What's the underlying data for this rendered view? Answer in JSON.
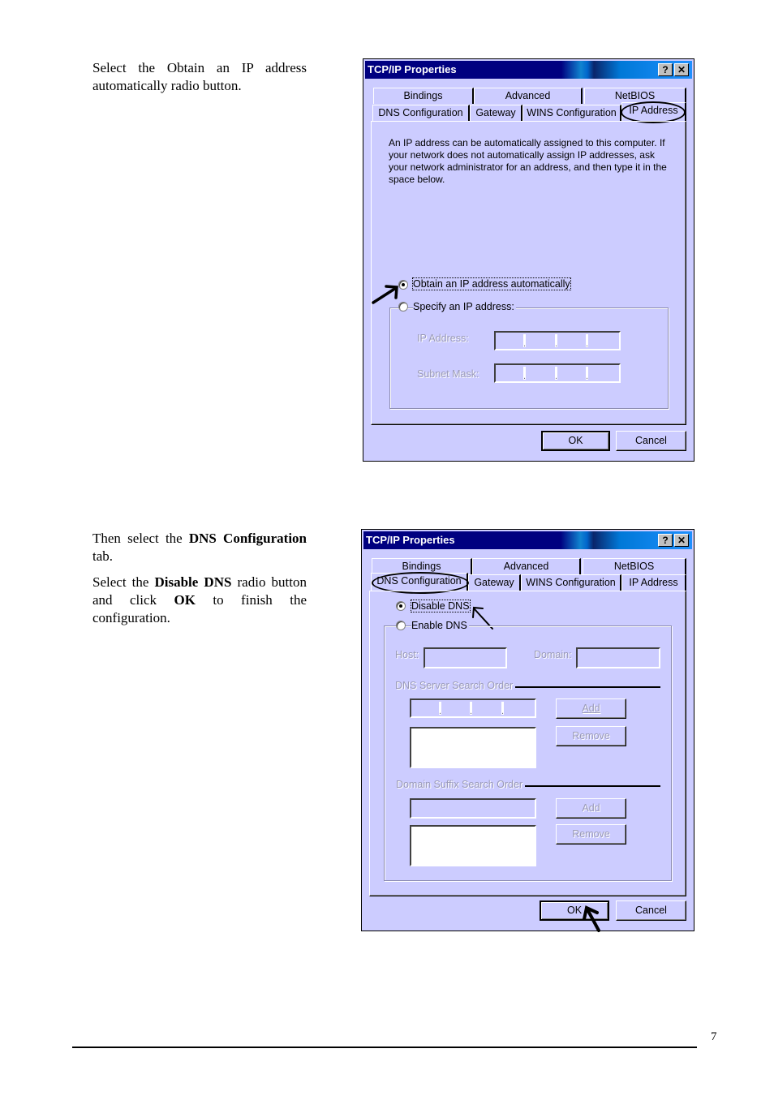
{
  "instructions": {
    "step1": "Select the Obtain an IP address automatically radio button.",
    "step2": {
      "pre": "Then select the ",
      "bold": "DNS Configuration",
      "post": " tab."
    },
    "step3": {
      "pre": "Select the ",
      "bold1": "Disable DNS",
      "mid": " radio button and click ",
      "bold2": "OK",
      "post": " to finish the configuration."
    }
  },
  "page_number": "7",
  "dialog1": {
    "title": "TCP/IP Properties",
    "help_button": "?",
    "close_button": "✕",
    "tabs_back": [
      "Bindings",
      "Advanced",
      "NetBIOS"
    ],
    "tabs_front": [
      "DNS Configuration",
      "Gateway",
      "WINS Configuration",
      "IP Address"
    ],
    "active_tab": "IP Address",
    "description": "An IP address can be automatically assigned to this computer. If your network does not automatically assign IP addresses, ask your network administrator for an address, and then type it in the space below.",
    "radio_obtain": "Obtain an IP address automatically",
    "radio_specify": "Specify an IP address:",
    "selected_radio": "obtain",
    "ip_address_label": "IP Address:",
    "subnet_mask_label": "Subnet Mask:",
    "ok": "OK",
    "cancel": "Cancel"
  },
  "dialog2": {
    "title": "TCP/IP Properties",
    "help_button": "?",
    "close_button": "✕",
    "tabs_back": [
      "Bindings",
      "Advanced",
      "NetBIOS"
    ],
    "tabs_front": [
      "DNS Configuration",
      "Gateway",
      "WINS Configuration",
      "IP Address"
    ],
    "active_tab": "DNS Configuration",
    "radio_disable": "Disable DNS",
    "radio_enable": "Enable DNS",
    "selected_radio": "disable",
    "host_label": "Host:",
    "domain_label": "Domain:",
    "dns_server_order_label": "DNS Server Search Order",
    "domain_suffix_order_label": "Domain Suffix Search Order",
    "add": "Add",
    "remove": "Remove",
    "ok": "OK",
    "cancel": "Cancel"
  }
}
